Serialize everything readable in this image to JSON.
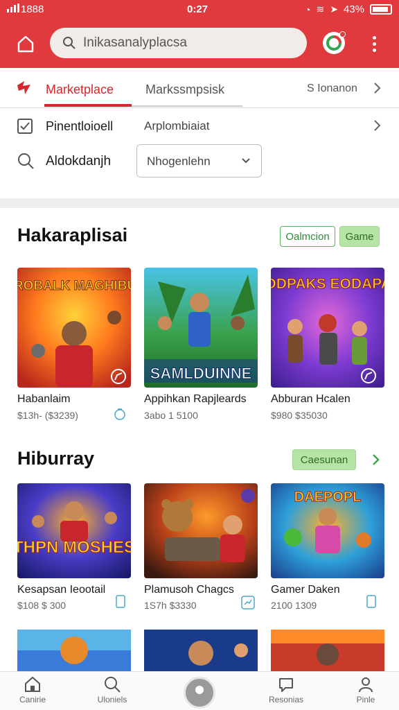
{
  "status": {
    "carrier": "1888",
    "time": "0:27",
    "battery": "43%"
  },
  "search": {
    "placeholder": "Inikasanalyplacsa"
  },
  "tabs": [
    {
      "label": "Marketplace"
    },
    {
      "label": "Markssmpsisk"
    },
    {
      "label": "S Ionanon"
    }
  ],
  "filters": {
    "row1_label": "Pinentloioell",
    "row1_value": "Arplombiaiat",
    "row2_label": "Aldokdanjh",
    "select_value": "Nhogenlehn"
  },
  "sections": [
    {
      "title": "Hakaraplisai",
      "buttons": [
        "Oalmcion",
        "Game"
      ],
      "items": [
        {
          "title": "Habanlaim",
          "price": "$13h- ($3239)",
          "art": "MROBALK MAGHIBUS",
          "icon": "refresh-icon"
        },
        {
          "title": "Appihkan Rapjleards",
          "price": "3abo 1 5100",
          "art": "SAMLDUINNE",
          "icon": "none"
        },
        {
          "title": "Abburan Hcalen",
          "price": "$980 $35030",
          "art": "DODPAKS EODAPAS",
          "icon": "compass-icon"
        }
      ]
    },
    {
      "title": "Hiburray",
      "buttons": [
        "Caesunan"
      ],
      "items": [
        {
          "title": "Kesapsan Ieootail",
          "price": "$108 $ 300",
          "art": "THPN MOSHES",
          "icon": "tablet-icon"
        },
        {
          "title": "Plamusoh Chagcs",
          "price": "1S7h $3330",
          "art": "",
          "icon": "map-icon"
        },
        {
          "title": "Gamer Daken",
          "price": "2100 1309",
          "art": "DAEPOPL",
          "icon": "tablet-icon"
        }
      ]
    }
  ],
  "nav": [
    {
      "label": "Canirie",
      "icon": "home-icon"
    },
    {
      "label": "Uloniels",
      "icon": "search-icon"
    },
    {
      "label": "",
      "icon": "profile-icon"
    },
    {
      "label": "Resonias",
      "icon": "chat-icon"
    },
    {
      "label": "Pinle",
      "icon": "user-icon"
    }
  ],
  "colors": {
    "accent": "#e0393e",
    "tab_active": "#d8262c",
    "green": "#52b35c"
  }
}
